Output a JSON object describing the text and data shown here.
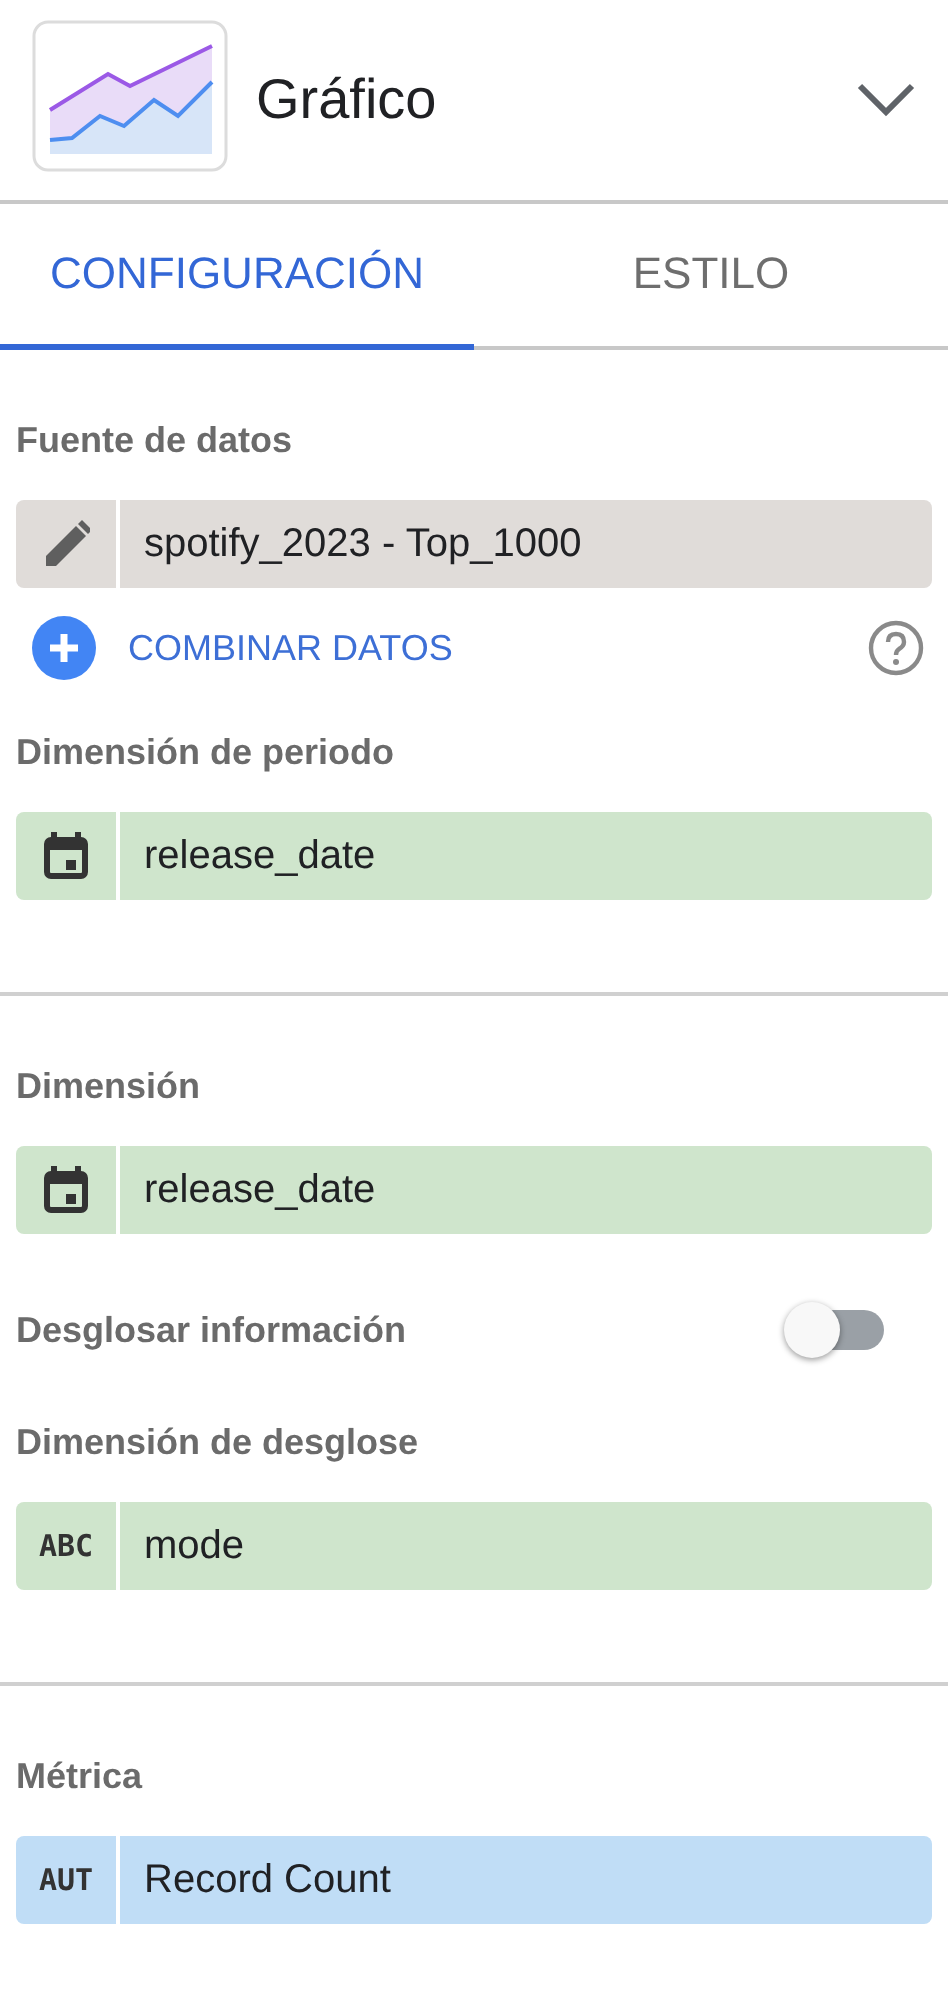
{
  "header": {
    "title": "Gráfico"
  },
  "tabs": [
    {
      "label": "CONFIGURACIÓN",
      "selected": true
    },
    {
      "label": "ESTILO",
      "selected": false
    }
  ],
  "sections": [
    {
      "items": [
        {
          "kind": "label",
          "text": "Fuente de datos"
        },
        {
          "kind": "source-field",
          "value": "spotify_2023 - Top_1000"
        },
        {
          "kind": "link",
          "text": "COMBINAR DATOS"
        },
        {
          "kind": "label",
          "text": "Dimensión de periodo"
        },
        {
          "kind": "date-field",
          "value": "release_date"
        }
      ]
    },
    {
      "items": [
        {
          "kind": "label",
          "text": "Dimensión"
        },
        {
          "kind": "date-field",
          "value": "release_date"
        },
        {
          "kind": "toggle",
          "text": "Desglosar información",
          "on": false
        },
        {
          "kind": "label",
          "text": "Dimensión de desglose"
        },
        {
          "kind": "text-field",
          "badge": "ABC",
          "value": "mode"
        }
      ]
    },
    {
      "items": [
        {
          "kind": "label",
          "text": "Métrica"
        },
        {
          "kind": "metric-field",
          "badge": "AUT",
          "value": "Record Count"
        }
      ]
    }
  ]
}
